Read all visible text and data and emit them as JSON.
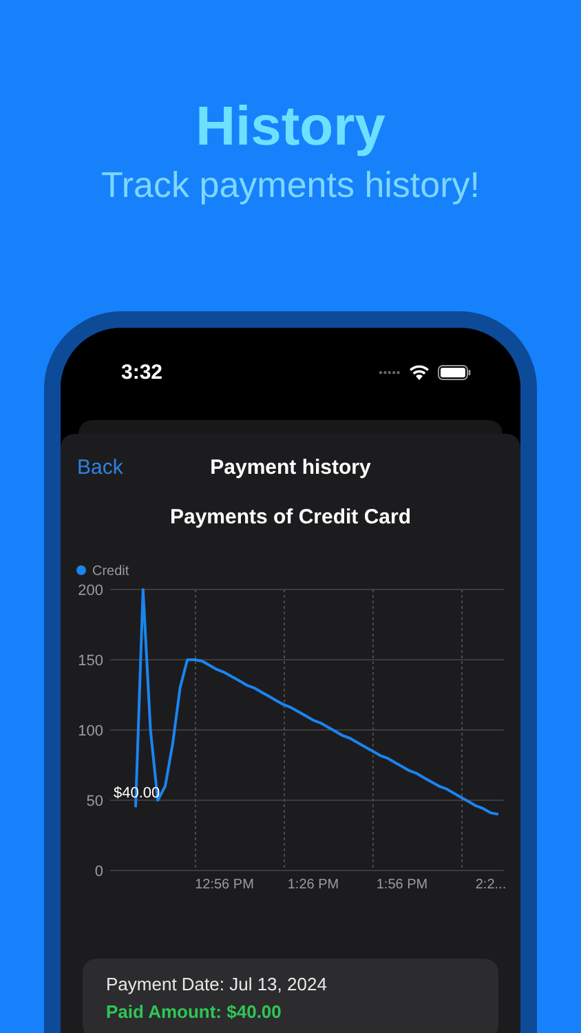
{
  "header": {
    "title": "History",
    "subtitle": "Track payments history!"
  },
  "status_bar": {
    "time": "3:32"
  },
  "nav": {
    "back": "Back",
    "title": "Payment history"
  },
  "chart_title": "Payments of Credit Card",
  "chart_data": {
    "type": "line",
    "grid": true,
    "ylim": [
      0,
      200
    ],
    "yticks": [
      0,
      50,
      100,
      150,
      200
    ],
    "categories": [
      null,
      null,
      null,
      null,
      null,
      null,
      null,
      null,
      null,
      null,
      null,
      null,
      null,
      null,
      "12:56 PM",
      null,
      null,
      null,
      null,
      null,
      null,
      null,
      null,
      null,
      null,
      null,
      "1:26 PM",
      null,
      null,
      null,
      null,
      null,
      null,
      null,
      null,
      null,
      null,
      null,
      "1:56 PM",
      null,
      null,
      null,
      null,
      null,
      null,
      null,
      null,
      null,
      null,
      null,
      "2:2...",
      null
    ],
    "series": [
      {
        "name": "Credit",
        "color": "#1a84f0",
        "values": [
          null,
          null,
          45,
          200,
          100,
          50,
          60,
          90,
          130,
          150,
          150,
          149,
          146,
          143,
          141,
          138,
          135,
          132,
          130,
          127,
          124,
          121,
          118,
          116,
          113,
          110,
          107,
          105,
          102,
          99,
          96,
          94,
          91,
          88,
          85,
          82,
          80,
          77,
          74,
          71,
          69,
          66,
          63,
          60,
          58,
          55,
          52,
          49,
          46,
          44,
          41,
          40
        ]
      }
    ],
    "annotations": [
      {
        "y": 40,
        "text": "$40.00"
      }
    ]
  },
  "payment": {
    "date": "Payment Date: Jul 13, 2024",
    "amount": "Paid Amount: $40.00"
  }
}
